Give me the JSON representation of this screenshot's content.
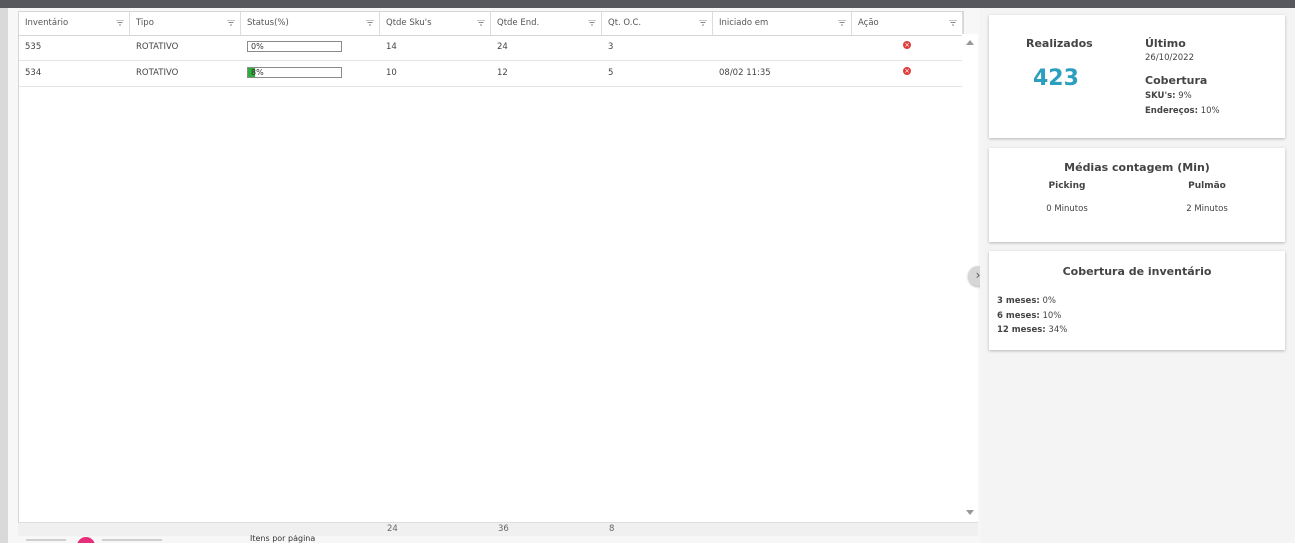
{
  "grid": {
    "columns": [
      {
        "label": "Inventário"
      },
      {
        "label": "Tipo"
      },
      {
        "label": "Status(%)"
      },
      {
        "label": "Qtde Sku's"
      },
      {
        "label": "Qtde End."
      },
      {
        "label": "Qt. O.C."
      },
      {
        "label": "Iniciado em"
      },
      {
        "label": "Ação"
      }
    ],
    "rows": [
      {
        "inventario": "535",
        "tipo": "ROTATIVO",
        "status_text": "0%",
        "status_value": 0,
        "qtde_skus": "14",
        "qtde_end": "24",
        "qt_oc": "3",
        "iniciado_em": ""
      },
      {
        "inventario": "534",
        "tipo": "ROTATIVO",
        "status_text": "8%",
        "status_value": 8,
        "qtde_skus": "10",
        "qtde_end": "12",
        "qt_oc": "5",
        "iniciado_em": "08/02 11:35"
      }
    ],
    "totals": {
      "qtde_skus": "24",
      "qtde_end": "36",
      "qt_oc": "8"
    }
  },
  "pager": {
    "label": "Itens por página"
  },
  "summary": {
    "realizados_label": "Realizados",
    "realizados_value": "423",
    "ultimo_label": "Último",
    "ultimo_value": "26/10/2022",
    "cobertura_label": "Cobertura",
    "skus_label": "SKU's:",
    "skus_value": "9%",
    "enderecos_label": "Endereços:",
    "enderecos_value": "10%"
  },
  "medias": {
    "title": "Médias contagem (Min)",
    "picking_label": "Picking",
    "picking_value": "0 Minutos",
    "pulmao_label": "Pulmão",
    "pulmao_value": "2 Minutos"
  },
  "cobertura_inv": {
    "title": "Cobertura de inventário",
    "items": [
      {
        "label": "3 meses:",
        "value": "0%"
      },
      {
        "label": "6 meses:",
        "value": "10%"
      },
      {
        "label": "12 meses:",
        "value": "34%"
      }
    ]
  },
  "colors": {
    "accent": "#2a9fc0",
    "progress": "#2eae3a",
    "delete": "#e03b3b",
    "pager_active": "#e62e7a"
  },
  "icons": {
    "filter": "filter-icon",
    "delete": "delete-circle-icon",
    "toggle": "chevron-right-icon"
  }
}
